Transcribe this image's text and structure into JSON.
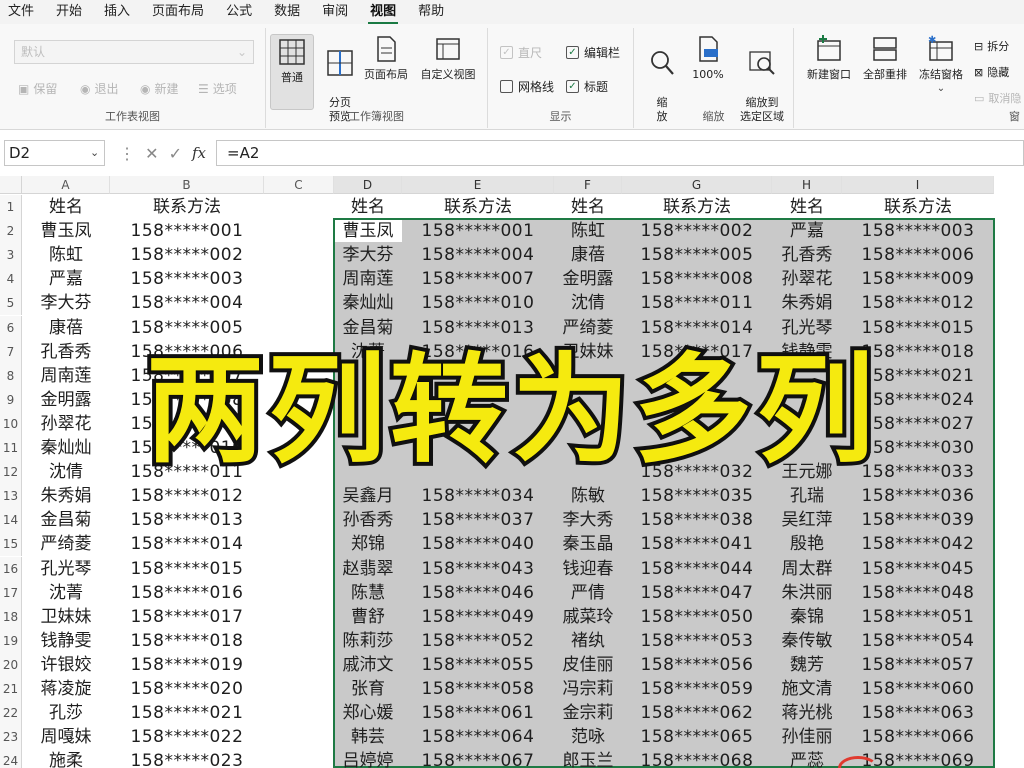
{
  "menu": {
    "tabs": [
      "文件",
      "开始",
      "插入",
      "页面布局",
      "公式",
      "数据",
      "审阅",
      "视图",
      "帮助"
    ],
    "active_tab": "视图"
  },
  "ribbon": {
    "workbook_views_group": {
      "title": "工作表视图",
      "select_value": "默认",
      "keep": "保留",
      "exit": "退出",
      "new": "新建",
      "options": "选项"
    },
    "workbook_view_group": {
      "title": "工作簿视图",
      "normal": "普通",
      "page_break": "分页\n预览",
      "page_layout": "页面布局",
      "custom_view": "自定义视图"
    },
    "show_group": {
      "title": "显示",
      "ruler": "直尺",
      "formula_bar": "编辑栏",
      "gridlines": "网格线",
      "headings": "标题"
    },
    "zoom_group": {
      "title": "缩放",
      "zoom": "缩\n放",
      "zoom_100": "100%",
      "zoom_selection": "缩放到\n选定区域"
    },
    "window_group": {
      "title": "窗",
      "new_window": "新建窗口",
      "arrange_all": "全部重排",
      "freeze_panes": "冻结窗格",
      "split": "拆分",
      "hide": "隐藏",
      "unhide": "取消隐"
    }
  },
  "formula_bar": {
    "name_box": "D2",
    "formula": "=A2",
    "fx": "fx"
  },
  "grid": {
    "columns": [
      "A",
      "B",
      "C",
      "D",
      "E",
      "F",
      "G",
      "H",
      "I"
    ],
    "selected_columns": [
      "D",
      "E",
      "F",
      "G",
      "H",
      "I"
    ],
    "rows": [
      "1",
      "2",
      "3",
      "4",
      "5",
      "6",
      "7",
      "8",
      "9",
      "10",
      "11",
      "12",
      "13",
      "14",
      "15",
      "16",
      "17",
      "18",
      "19",
      "20",
      "21",
      "22",
      "23",
      "24"
    ],
    "source_header": [
      "姓名",
      "联系方法"
    ],
    "source": [
      [
        "曹玉凤",
        "158*****001"
      ],
      [
        "陈虹",
        "158*****002"
      ],
      [
        "严嘉",
        "158*****003"
      ],
      [
        "李大芬",
        "158*****004"
      ],
      [
        "康蓓",
        "158*****005"
      ],
      [
        "孔香秀",
        "158*****006"
      ],
      [
        "周南莲",
        "158*****007"
      ],
      [
        "金明露",
        "158*****008"
      ],
      [
        "孙翠花",
        "158*****009"
      ],
      [
        "秦灿灿",
        "158*****010"
      ],
      [
        "沈倩",
        "158*****011"
      ],
      [
        "朱秀娟",
        "158*****012"
      ],
      [
        "金昌菊",
        "158*****013"
      ],
      [
        "严绮菱",
        "158*****014"
      ],
      [
        "孔光琴",
        "158*****015"
      ],
      [
        "沈菁",
        "158*****016"
      ],
      [
        "卫妹妹",
        "158*****017"
      ],
      [
        "钱静雯",
        "158*****018"
      ],
      [
        "许银姣",
        "158*****019"
      ],
      [
        "蒋凌旋",
        "158*****020"
      ],
      [
        "孔莎",
        "158*****021"
      ],
      [
        "周嘎妹",
        "158*****022"
      ],
      [
        "施柔",
        "158*****023"
      ]
    ],
    "result_header": [
      "姓名",
      "联系方法",
      "姓名",
      "联系方法",
      "姓名",
      "联系方法"
    ],
    "result": [
      [
        "曹玉凤",
        "158*****001",
        "陈虹",
        "158*****002",
        "严嘉",
        "158*****003"
      ],
      [
        "李大芬",
        "158*****004",
        "康蓓",
        "158*****005",
        "孔香秀",
        "158*****006"
      ],
      [
        "周南莲",
        "158*****007",
        "金明露",
        "158*****008",
        "孙翠花",
        "158*****009"
      ],
      [
        "秦灿灿",
        "158*****010",
        "沈倩",
        "158*****011",
        "朱秀娟",
        "158*****012"
      ],
      [
        "金昌菊",
        "158*****013",
        "严绮菱",
        "158*****014",
        "孔光琴",
        "158*****015"
      ],
      [
        "沈菁",
        "158*****016",
        "卫妹妹",
        "158*****017",
        "钱静雯",
        "158*****018"
      ],
      [
        "",
        "",
        "",
        "",
        "",
        "158*****021"
      ],
      [
        "",
        "",
        "",
        "",
        "",
        "158*****024"
      ],
      [
        "",
        "",
        "",
        "",
        "",
        "158*****027"
      ],
      [
        "",
        "",
        "",
        "",
        "",
        "158*****030"
      ],
      [
        "",
        "",
        "",
        "158*****032",
        "王元娜",
        "158*****033"
      ],
      [
        "吴鑫月",
        "158*****034",
        "陈敏",
        "158*****035",
        "孔瑞",
        "158*****036"
      ],
      [
        "孙香秀",
        "158*****037",
        "李大秀",
        "158*****038",
        "吴红萍",
        "158*****039"
      ],
      [
        "郑锦",
        "158*****040",
        "秦玉晶",
        "158*****041",
        "殷艳",
        "158*****042"
      ],
      [
        "赵翡翠",
        "158*****043",
        "钱迎春",
        "158*****044",
        "周太群",
        "158*****045"
      ],
      [
        "陈慧",
        "158*****046",
        "严倩",
        "158*****047",
        "朱洪丽",
        "158*****048"
      ],
      [
        "曹舒",
        "158*****049",
        "戚菜玲",
        "158*****050",
        "秦锦",
        "158*****051"
      ],
      [
        "陈莉莎",
        "158*****052",
        "褚纨",
        "158*****053",
        "秦传敏",
        "158*****054"
      ],
      [
        "戚沛文",
        "158*****055",
        "皮佳丽",
        "158*****056",
        "魏芳",
        "158*****057"
      ],
      [
        "张育",
        "158*****058",
        "冯宗莉",
        "158*****059",
        "施文清",
        "158*****060"
      ],
      [
        "郑心媛",
        "158*****061",
        "金宗莉",
        "158*****062",
        "蒋光桃",
        "158*****063"
      ],
      [
        "韩芸",
        "158*****064",
        "范咏",
        "158*****065",
        "孙佳丽",
        "158*****066"
      ],
      [
        "吕婷婷",
        "158*****067",
        "郎玉兰",
        "158*****068",
        "严蕊",
        "158*****069"
      ]
    ]
  },
  "overlay": {
    "title": "两列转为多列"
  },
  "colors": {
    "accent": "#1e7a44",
    "selection_fill": "#c9c9c9",
    "overlay_text": "#f5ea0f",
    "overlay_stroke": "#111111"
  }
}
